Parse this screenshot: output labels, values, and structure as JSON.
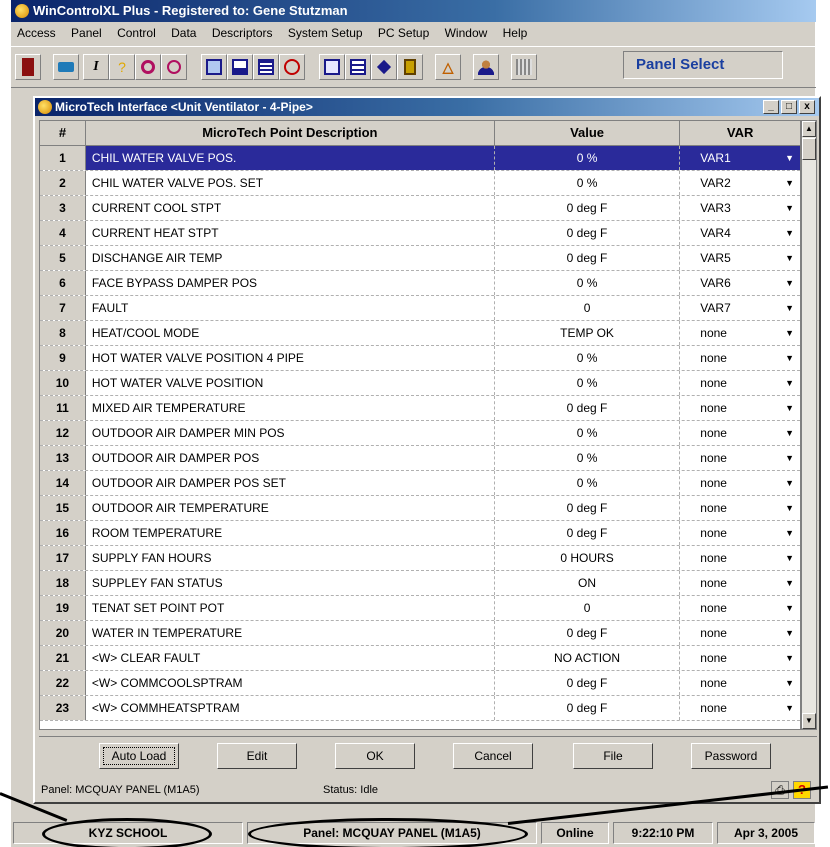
{
  "window": {
    "title": "WinControlXL Plus - Registered to: Gene Stutzman"
  },
  "menubar": [
    "Access",
    "Panel",
    "Control",
    "Data",
    "Descriptors",
    "System Setup",
    "PC Setup",
    "Window",
    "Help"
  ],
  "toolbar": {
    "buttons": [
      "exit-icon",
      "open-icon",
      "italic-icon",
      "tips-icon",
      "refresh-icon",
      "settings-icon",
      "view-icon",
      "chart-icon",
      "monitor-icon",
      "alarm-icon",
      "print-icon",
      "list-icon",
      "edit-icon",
      "panel-icon",
      "warning-icon",
      "users-icon",
      "grid-icon"
    ],
    "panel_select_label": "Panel Select"
  },
  "child_window": {
    "title": "MicroTech Interface <Unit Ventilator - 4-Pipe>",
    "controls": [
      "_",
      "□",
      "x"
    ]
  },
  "grid": {
    "headers": {
      "num": "#",
      "description": "MicroTech Point Description",
      "value": "Value",
      "var": "VAR"
    },
    "selected_row": 0,
    "rows": [
      {
        "num": "1",
        "description": "CHIL WATER VALVE POS.",
        "value": "0 %",
        "var": "VAR1"
      },
      {
        "num": "2",
        "description": "CHIL WATER VALVE POS. SET",
        "value": "0 %",
        "var": "VAR2"
      },
      {
        "num": "3",
        "description": "CURRENT COOL STPT",
        "value": "0 deg F",
        "var": "VAR3"
      },
      {
        "num": "4",
        "description": "CURRENT HEAT STPT",
        "value": "0 deg F",
        "var": "VAR4"
      },
      {
        "num": "5",
        "description": "DISCHANGE AIR TEMP",
        "value": "0 deg F",
        "var": "VAR5"
      },
      {
        "num": "6",
        "description": "FACE BYPASS DAMPER POS",
        "value": "0 %",
        "var": "VAR6"
      },
      {
        "num": "7",
        "description": "FAULT",
        "value": "0",
        "var": "VAR7"
      },
      {
        "num": "8",
        "description": "HEAT/COOL MODE",
        "value": "TEMP OK",
        "var": "none"
      },
      {
        "num": "9",
        "description": "HOT WATER VALVE POSITION 4 PIPE",
        "value": "0 %",
        "var": "none"
      },
      {
        "num": "10",
        "description": "HOT WATER VALVE POSITION",
        "value": "0 %",
        "var": "none"
      },
      {
        "num": "11",
        "description": "MIXED AIR TEMPERATURE",
        "value": "0 deg F",
        "var": "none"
      },
      {
        "num": "12",
        "description": "OUTDOOR AIR DAMPER MIN POS",
        "value": "0 %",
        "var": "none"
      },
      {
        "num": "13",
        "description": "OUTDOOR AIR DAMPER POS",
        "value": "0 %",
        "var": "none"
      },
      {
        "num": "14",
        "description": "OUTDOOR AIR DAMPER POS SET",
        "value": "0 %",
        "var": "none"
      },
      {
        "num": "15",
        "description": "OUTDOOR AIR TEMPERATURE",
        "value": "0 deg F",
        "var": "none"
      },
      {
        "num": "16",
        "description": "ROOM TEMPERATURE",
        "value": "0 deg F",
        "var": "none"
      },
      {
        "num": "17",
        "description": "SUPPLY FAN HOURS",
        "value": "0 HOURS",
        "var": "none"
      },
      {
        "num": "18",
        "description": "SUPPLEY FAN STATUS",
        "value": "ON",
        "var": "none"
      },
      {
        "num": "19",
        "description": "TENAT SET POINT POT",
        "value": "0",
        "var": "none"
      },
      {
        "num": "20",
        "description": "WATER IN TEMPERATURE",
        "value": "0 deg F",
        "var": "none"
      },
      {
        "num": "21",
        "description": "<W> CLEAR FAULT",
        "value": "NO ACTION",
        "var": "none"
      },
      {
        "num": "22",
        "description": "<W> COMMCOOLSPTRAM",
        "value": "0 deg F",
        "var": "none"
      },
      {
        "num": "23",
        "description": "<W> COMMHEATSPTRAM",
        "value": "0 deg F",
        "var": "none"
      }
    ]
  },
  "buttons": {
    "auto_load": "Auto Load",
    "edit": "Edit",
    "ok": "OK",
    "cancel": "Cancel",
    "file": "File",
    "password": "Password"
  },
  "child_status": {
    "panel": "Panel: MCQUAY PANEL (M1A5)",
    "status": "Status: Idle"
  },
  "statusbar": {
    "site": "KYZ SCHOOL",
    "panel": "Panel: MCQUAY PANEL (M1A5)",
    "connection": "Online",
    "time": "9:22:10 PM",
    "date": "Apr 3, 2005"
  },
  "colors": {
    "title_active": "#0a246a",
    "selection": "#2a2a9a",
    "face": "#d4d0c8",
    "panel_select_text": "#1a3fa0"
  }
}
